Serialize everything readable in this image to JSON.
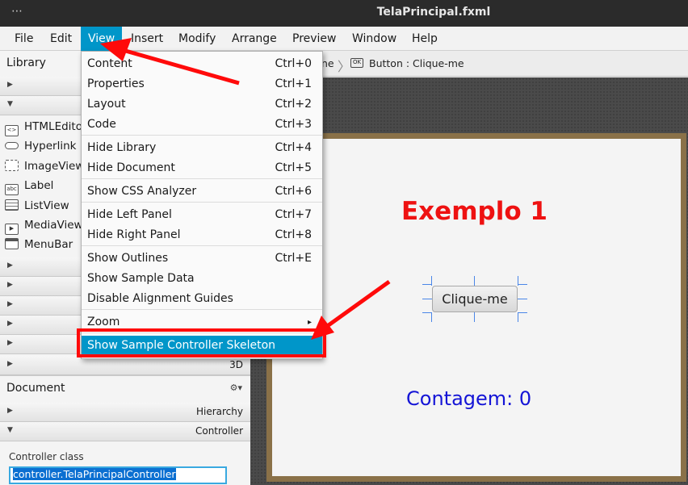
{
  "window": {
    "dots": "⋯",
    "title": "TelaPrincipal.fxml"
  },
  "menubar": {
    "items": [
      "File",
      "Edit",
      "View",
      "Insert",
      "Modify",
      "Arrange",
      "Preview",
      "Window",
      "Help"
    ]
  },
  "library": {
    "title": "Library",
    "items": [
      {
        "label": "HTMLEdito",
        "icon": "html-editor-icon"
      },
      {
        "label": "Hyperlink",
        "icon": "hyperlink-icon"
      },
      {
        "label": "ImageView",
        "icon": "image-view-icon"
      },
      {
        "label": "Label",
        "icon": "label-icon"
      },
      {
        "label": "ListView",
        "icon": "list-view-icon"
      },
      {
        "label": "MediaView",
        "icon": "media-view-icon"
      },
      {
        "label": "MenuBar",
        "icon": "menu-bar-icon"
      }
    ],
    "last_section": "3D"
  },
  "breadcrumb": {
    "prev": "ne",
    "current": "Button : Clique-me"
  },
  "view_menu": {
    "groups": [
      [
        {
          "label": "Content",
          "shortcut": "Ctrl+0"
        },
        {
          "label": "Properties",
          "shortcut": "Ctrl+1"
        },
        {
          "label": "Layout",
          "shortcut": "Ctrl+2"
        },
        {
          "label": "Code",
          "shortcut": "Ctrl+3"
        }
      ],
      [
        {
          "label": "Hide Library",
          "shortcut": "Ctrl+4"
        },
        {
          "label": "Hide Document",
          "shortcut": "Ctrl+5"
        }
      ],
      [
        {
          "label": "Show CSS Analyzer",
          "shortcut": "Ctrl+6"
        }
      ],
      [
        {
          "label": "Hide Left Panel",
          "shortcut": "Ctrl+7"
        },
        {
          "label": "Hide Right Panel",
          "shortcut": "Ctrl+8"
        }
      ],
      [
        {
          "label": "Show Outlines",
          "shortcut": "Ctrl+E"
        },
        {
          "label": "Show Sample Data",
          "shortcut": ""
        },
        {
          "label": "Disable Alignment Guides",
          "shortcut": ""
        }
      ],
      [
        {
          "label": "Zoom",
          "shortcut": "▸"
        }
      ],
      [
        {
          "label": "Show Sample Controller Skeleton",
          "shortcut": ""
        }
      ]
    ]
  },
  "stage": {
    "heading": "Exemplo 1",
    "button": "Clique-me",
    "counter": "Contagem: 0"
  },
  "document": {
    "title": "Document",
    "gear": "⚙▾",
    "hierarchy": "Hierarchy",
    "controller": "Controller",
    "controller_class_label": "Controller class",
    "controller_class_value": "controller.TelaPrincipalController"
  },
  "colors": {
    "accent": "#0096c9",
    "annotation": "#ff0a0a",
    "heading": "#ee1111",
    "counter": "#1414d6"
  }
}
